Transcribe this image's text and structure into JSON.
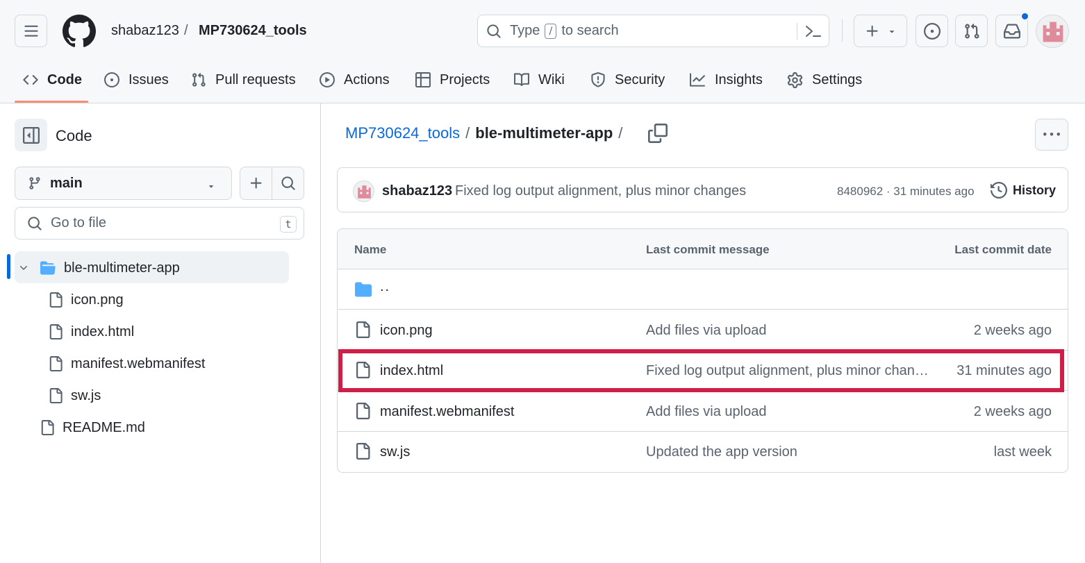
{
  "header": {
    "owner": "shabaz123",
    "separator": "/",
    "repo": "MP730624_tools",
    "search": {
      "prefix": "Type",
      "key": "/",
      "suffix": "to search"
    },
    "plus_label": "+"
  },
  "tabs": [
    {
      "label": "Code",
      "icon": "code-icon",
      "active": true
    },
    {
      "label": "Issues",
      "icon": "issue-opened-icon"
    },
    {
      "label": "Pull requests",
      "icon": "git-pull-request-icon"
    },
    {
      "label": "Actions",
      "icon": "play-icon"
    },
    {
      "label": "Projects",
      "icon": "table-icon"
    },
    {
      "label": "Wiki",
      "icon": "book-icon"
    },
    {
      "label": "Security",
      "icon": "shield-icon"
    },
    {
      "label": "Insights",
      "icon": "graph-icon"
    },
    {
      "label": "Settings",
      "icon": "gear-icon"
    }
  ],
  "sidebar": {
    "title": "Code",
    "branch": "main",
    "go_to_file_placeholder": "Go to file",
    "go_to_file_key": "t",
    "tree": [
      {
        "label": "ble-multimeter-app",
        "type": "folder",
        "selected": true
      },
      {
        "label": "icon.png",
        "type": "file"
      },
      {
        "label": "index.html",
        "type": "file"
      },
      {
        "label": "manifest.webmanifest",
        "type": "file"
      },
      {
        "label": "sw.js",
        "type": "file"
      },
      {
        "label": "README.md",
        "type": "file"
      }
    ]
  },
  "breadcrumb": {
    "root": "MP730624_tools",
    "sep": "/",
    "current": "ble-multimeter-app",
    "trailing": "/"
  },
  "commit": {
    "author": "shabaz123",
    "message": "Fixed log output alignment, plus minor changes",
    "meta": "8480962 · 31 minutes ago",
    "history_label": "History"
  },
  "table": {
    "headers": {
      "name": "Name",
      "message": "Last commit message",
      "date": "Last commit date"
    },
    "parent": "..",
    "rows": [
      {
        "name": "icon.png",
        "message": "Add files via upload",
        "date": "2 weeks ago"
      },
      {
        "name": "index.html",
        "message": "Fixed log output alignment, plus minor changes",
        "date": "31 minutes ago",
        "highlighted": true
      },
      {
        "name": "manifest.webmanifest",
        "message": "Add files via upload",
        "date": "2 weeks ago"
      },
      {
        "name": "sw.js",
        "message": "Updated the app version",
        "date": "last week"
      }
    ]
  },
  "colors": {
    "accent": "#0969da",
    "tab_underline": "#fd8c73",
    "highlight": "#cf1f48",
    "folder": "#54aeff"
  }
}
